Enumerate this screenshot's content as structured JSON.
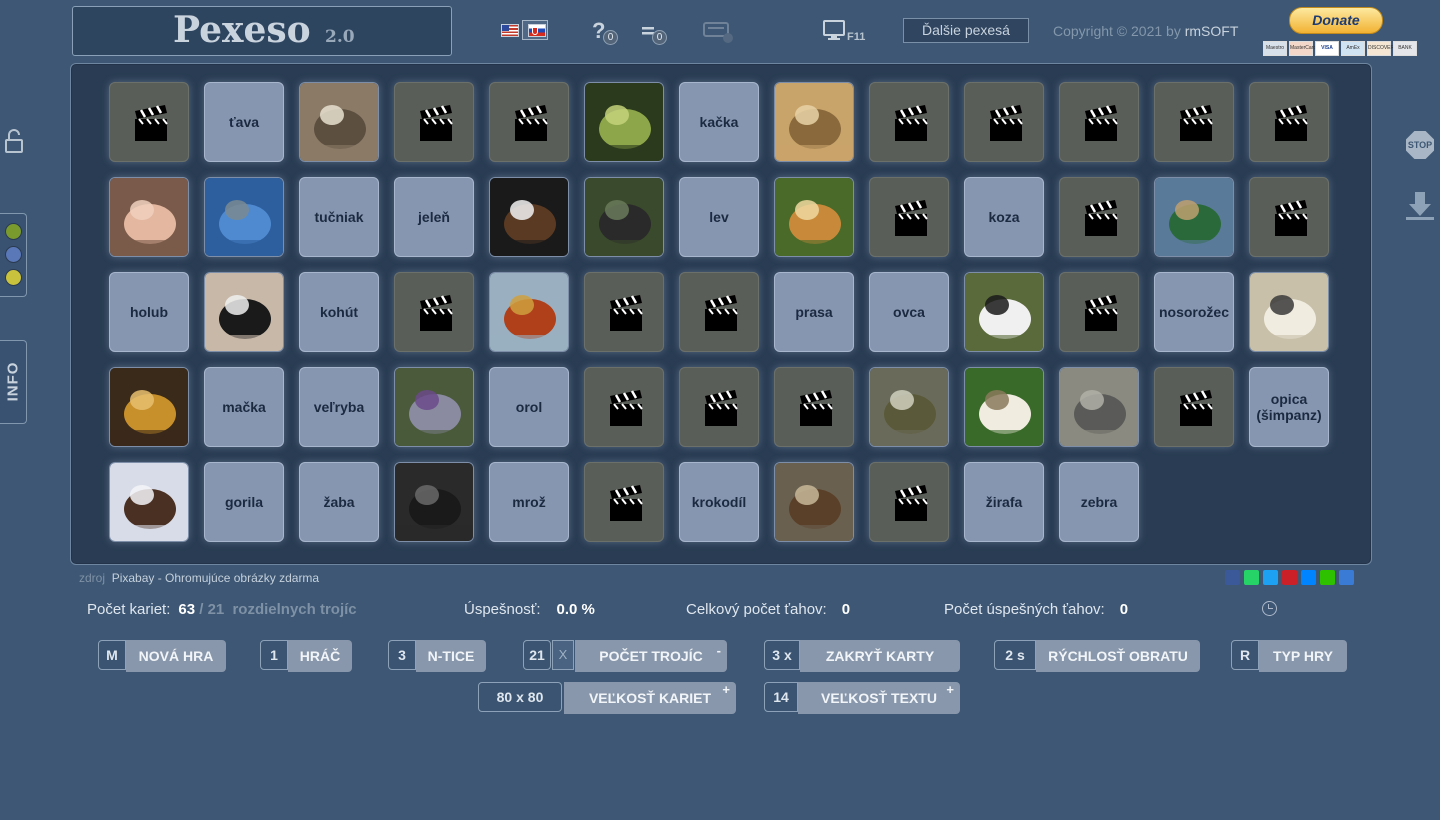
{
  "header": {
    "title": "Pexeso",
    "version": "2.0",
    "help_icon": "?",
    "help_count": "0",
    "list_count": "0",
    "fullscreen_key": "F11",
    "more_games": "Ďalšie pexesá",
    "copyright_prefix": "Copyright © 2021 by",
    "copyright_brand": "rmSOFT",
    "donate": "Donate",
    "payment_cards": [
      "Maestro",
      "MasterCard",
      "VISA",
      "AmEx",
      "DISCOVER",
      "BANK"
    ]
  },
  "side": {
    "info_label": "INFO",
    "colors": [
      "#7a9a2e",
      "#5a78b8",
      "#c9c23c"
    ],
    "stop_label": "STOP"
  },
  "board": {
    "rows": [
      [
        {
          "t": "h"
        },
        {
          "t": "x",
          "v": "ťava"
        },
        {
          "t": "i",
          "v": "cat"
        },
        {
          "t": "h"
        },
        {
          "t": "h"
        },
        {
          "t": "i",
          "v": "frog"
        },
        {
          "t": "x",
          "v": "kačka"
        },
        {
          "t": "i",
          "v": "camel"
        },
        {
          "t": "h"
        },
        {
          "t": "h"
        },
        {
          "t": "h"
        },
        {
          "t": "h"
        },
        {
          "t": "h"
        }
      ],
      [
        {
          "t": "i",
          "v": "pig"
        },
        {
          "t": "i",
          "v": "whale"
        },
        {
          "t": "x",
          "v": "tučniak"
        },
        {
          "t": "x",
          "v": "jeleň"
        },
        {
          "t": "i",
          "v": "eagle"
        },
        {
          "t": "i",
          "v": "gorilla"
        },
        {
          "t": "x",
          "v": "lev"
        },
        {
          "t": "i",
          "v": "giraffe"
        },
        {
          "t": "h"
        },
        {
          "t": "x",
          "v": "koza"
        },
        {
          "t": "h"
        },
        {
          "t": "i",
          "v": "duck"
        },
        {
          "t": "h"
        }
      ],
      [
        {
          "t": "x",
          "v": "holub"
        },
        {
          "t": "i",
          "v": "penguins"
        },
        {
          "t": "x",
          "v": "kohút"
        },
        {
          "t": "h"
        },
        {
          "t": "i",
          "v": "rooster"
        },
        {
          "t": "h"
        },
        {
          "t": "h"
        },
        {
          "t": "x",
          "v": "prasa"
        },
        {
          "t": "x",
          "v": "ovca"
        },
        {
          "t": "i",
          "v": "zebra"
        },
        {
          "t": "h"
        },
        {
          "t": "x",
          "v": "nosorožec"
        },
        {
          "t": "i",
          "v": "sheep"
        }
      ],
      [
        {
          "t": "i",
          "v": "lion"
        },
        {
          "t": "x",
          "v": "mačka"
        },
        {
          "t": "x",
          "v": "veľryba"
        },
        {
          "t": "i",
          "v": "pigeon"
        },
        {
          "t": "x",
          "v": "orol"
        },
        {
          "t": "h"
        },
        {
          "t": "h"
        },
        {
          "t": "h"
        },
        {
          "t": "i",
          "v": "crocodile"
        },
        {
          "t": "i",
          "v": "goat"
        },
        {
          "t": "i",
          "v": "rhino"
        },
        {
          "t": "h"
        },
        {
          "t": "x",
          "v": "opica\n(šimpanz)"
        }
      ],
      [
        {
          "t": "i",
          "v": "walrus"
        },
        {
          "t": "x",
          "v": "gorila"
        },
        {
          "t": "x",
          "v": "žaba"
        },
        {
          "t": "i",
          "v": "chimp"
        },
        {
          "t": "x",
          "v": "mrož"
        },
        {
          "t": "h"
        },
        {
          "t": "x",
          "v": "krokodíl"
        },
        {
          "t": "i",
          "v": "deer"
        },
        {
          "t": "h"
        },
        {
          "t": "x",
          "v": "žirafa"
        },
        {
          "t": "x",
          "v": "zebra"
        }
      ]
    ]
  },
  "footer": {
    "source_label": "zdroj",
    "source_name": "Pixabay - Ohromujúce obrázky zdarma",
    "cards_label": "Počet kariet:",
    "cards_value": "63",
    "cards_sep": "/",
    "groups_value": "21",
    "groups_label": "rozdielnych trojíc",
    "success_label": "Úspešnosť:",
    "success_value": "0.0 %",
    "moves_label": "Celkový počet ťahov:",
    "moves_value": "0",
    "good_moves_label": "Počet úspešných ťahov:",
    "good_moves_value": "0"
  },
  "controls": {
    "new_game": {
      "key": "M",
      "label": "NOVÁ HRA"
    },
    "player": {
      "key": "1",
      "label": "HRÁČ"
    },
    "ntice": {
      "key": "3",
      "label": "N-TICE"
    },
    "triples": {
      "key": "21",
      "x": "X",
      "label": "POČET TROJÍC"
    },
    "cover": {
      "key": "3 x",
      "label": "ZAKRYŤ KARTY"
    },
    "speed": {
      "key": "2 s",
      "label": "RÝCHLOSŤ OBRATU"
    },
    "game_type": {
      "key": "R",
      "label": "TYP HRY"
    },
    "card_size": {
      "key": "80 x 80",
      "label": "VEĽKOSŤ KARIET"
    },
    "text_size": {
      "key": "14",
      "label": "VEĽKOSŤ TEXTU"
    }
  }
}
